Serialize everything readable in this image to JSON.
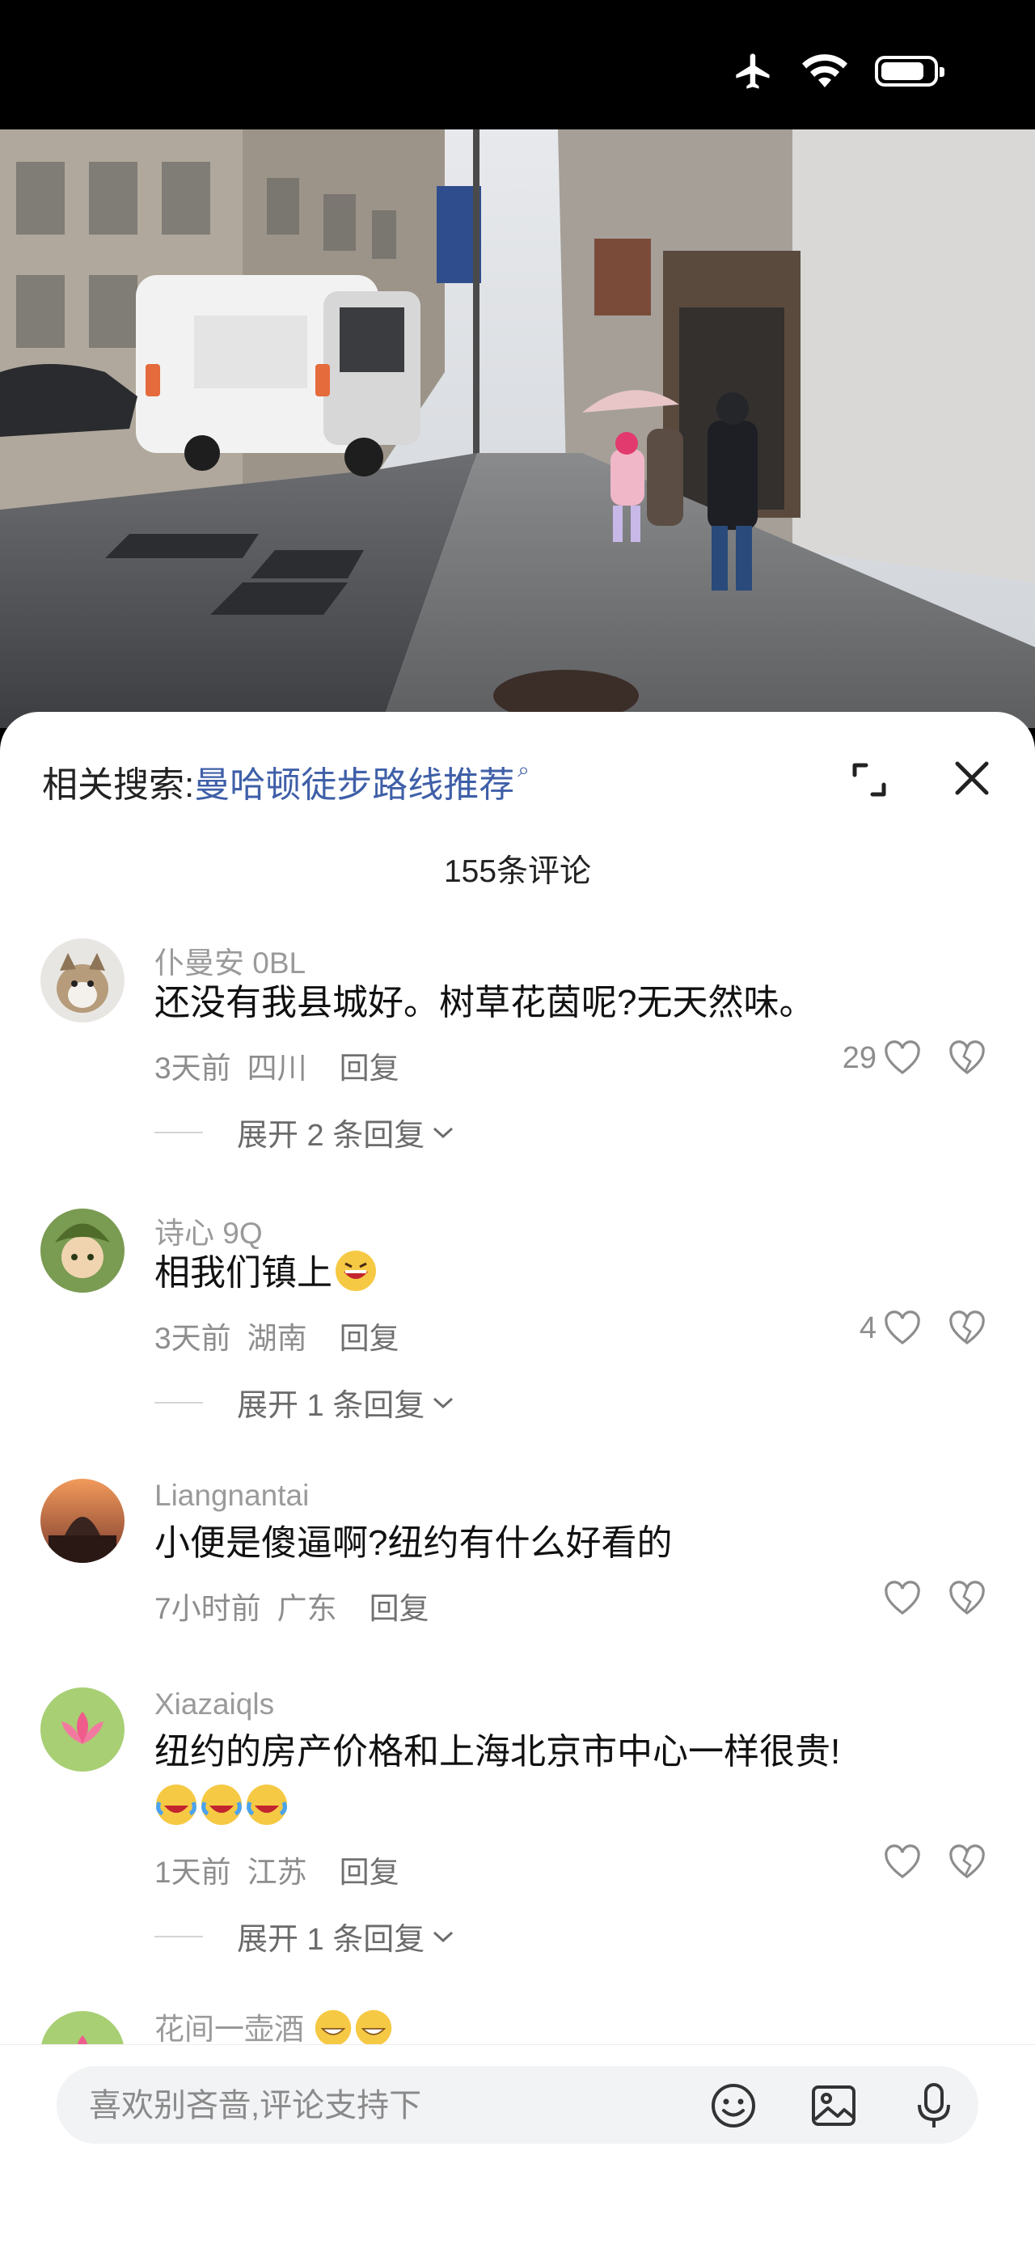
{
  "related_search": {
    "label": "相关搜索:",
    "query": "曼哈顿徒步路线推荐"
  },
  "comments_count": "155条评论",
  "comments": [
    {
      "user": "仆曼安 0BL",
      "text": "还没有我县城好。树草花茵呢?无天然味。",
      "time": "3天前",
      "location": "四川",
      "reply": "回复",
      "likes": "29",
      "expand": "展开 2 条回复"
    },
    {
      "user": "诗心 9Q",
      "text": "相我们镇上",
      "time": "3天前",
      "location": "湖南",
      "reply": "回复",
      "likes": "4",
      "expand": "展开 1 条回复"
    },
    {
      "user": "Liangnantai",
      "text": "小便是傻逼啊?纽约有什么好看的",
      "time": "7小时前",
      "location": "广东",
      "reply": "回复",
      "likes": ""
    },
    {
      "user": "Xiazaiqls",
      "text": "纽约的房产价格和上海北京市中心一样很贵!",
      "time": "1天前",
      "location": "江苏",
      "reply": "回复",
      "likes": "",
      "expand": "展开 1 条回复"
    },
    {
      "user": "花间一壶酒"
    }
  ],
  "input": {
    "placeholder": "喜欢别吝啬,评论支持下"
  },
  "colors": {
    "link": "#3f5fa8",
    "sheet_bg": "#ffffff",
    "input_bg": "#f2f3f5"
  }
}
